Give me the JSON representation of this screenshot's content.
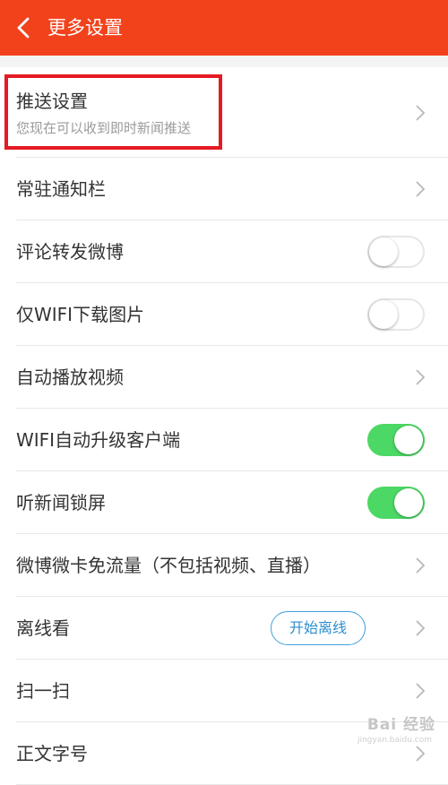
{
  "header": {
    "title": "更多设置",
    "background_color": "#f2421c",
    "back_icon": "chevron-left-icon"
  },
  "rows": [
    {
      "label": "推送设置",
      "sub": "您现在可以收到即时新闻推送",
      "control": "chevron",
      "highlighted": true
    },
    {
      "label": "常驻通知栏",
      "control": "chevron"
    },
    {
      "label": "评论转发微博",
      "control": "toggle",
      "on": false
    },
    {
      "label": "仅WIFI下载图片",
      "control": "toggle",
      "on": false
    },
    {
      "label": "自动播放视频",
      "control": "chevron"
    },
    {
      "label": "WIFI自动升级客户端",
      "control": "toggle",
      "on": true
    },
    {
      "label": "听新闻锁屏",
      "control": "toggle",
      "on": true
    },
    {
      "label": "微博微卡免流量（不包括视频、直播）",
      "control": "chevron"
    },
    {
      "label": "离线看",
      "control": "chevron",
      "button_label": "开始离线"
    },
    {
      "label": "扫一扫",
      "control": "chevron"
    },
    {
      "label": "正文字号",
      "control": "chevron"
    }
  ],
  "colors": {
    "toggle_on": "#4cd864",
    "highlight_box": "#e41a23",
    "pill_border": "#3fa0d9"
  },
  "watermark": {
    "text": "Bai 经验",
    "sub": "jingyan.baidu.com"
  }
}
